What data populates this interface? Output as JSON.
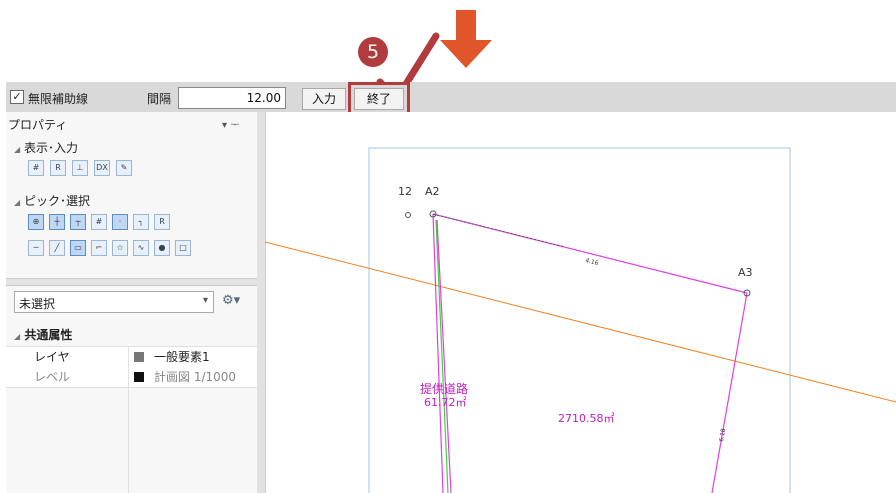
{
  "callout": {
    "number": "5",
    "arrow_color": "#e0562a",
    "badge_color": "#b23b3e",
    "check_color": "#b23b3e"
  },
  "toolbar": {
    "checkbox_label": "無限補助線",
    "interval_label": "間隔",
    "interval_value": "12.00",
    "input_button": "入力",
    "end_button": "終了"
  },
  "props": {
    "title": "プロパティ",
    "pin": "▾ ᅮ",
    "section_display": "表示･入力",
    "section_pick": "ピック･選択",
    "selection_value": "未選択",
    "common_header": "共通属性",
    "layer_label": "レイヤ",
    "layer_value": "一般要素1",
    "level_label": "レベル",
    "level_value": "計画図 1/1000"
  },
  "drawing": {
    "label_12": "12",
    "label_a2": "A2",
    "label_a3": "A3",
    "road_name": "提供道路",
    "road_area": "61.72㎡",
    "lot_area": "2710.58㎡",
    "line_color_magenta": "#e040e0",
    "line_color_green": "#40d040",
    "line_color_orange": "#f08020",
    "frame_color": "#9cc8e8"
  }
}
